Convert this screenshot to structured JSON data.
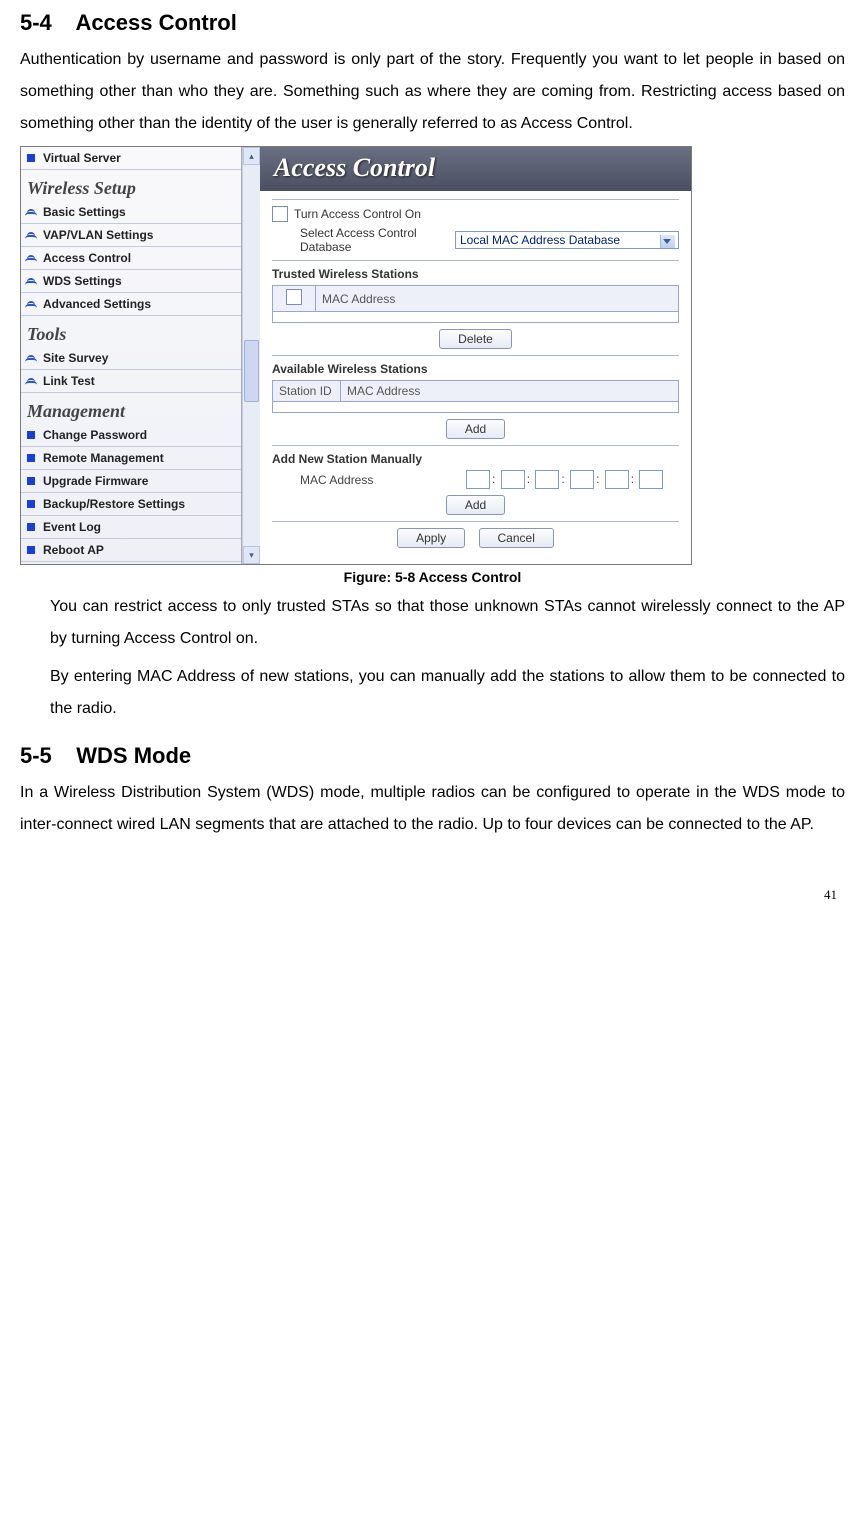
{
  "sections": {
    "s1_num": "5-4",
    "s1_title": "Access Control",
    "s1_p1": "Authentication by username and password is only part of the story. Frequently you want to let people in based on something other than who they are. Something such as where they are coming from. Restricting access based on something other than the identity of the user is generally referred to as Access Control.",
    "caption": "Figure: 5-8 Access Control",
    "after1": "You can restrict access to only trusted STAs so that those unknown STAs cannot wirelessly connect to the AP by turning Access Control on.",
    "after2": "By entering MAC Address of new stations, you can manually add the stations to allow them to be connected to the radio.",
    "s2_num": "5-5",
    "s2_title": "WDS Mode",
    "s2_p1": "In a Wireless Distribution System (WDS) mode, multiple radios can be configured to operate in the WDS mode to inter-connect wired LAN segments that are attached to the radio. Up to four devices can be connected to the AP."
  },
  "sidebar": {
    "virtual_server": "Virtual Server",
    "h_wireless": "Wireless Setup",
    "basic": "Basic Settings",
    "vap": "VAP/VLAN Settings",
    "access": "Access Control",
    "wds": "WDS Settings",
    "adv": "Advanced Settings",
    "h_tools": "Tools",
    "site": "Site Survey",
    "link": "Link Test",
    "h_mgmt": "Management",
    "change_pw": "Change Password",
    "remote": "Remote Management",
    "upgrade": "Upgrade Firmware",
    "backup": "Backup/Restore Settings",
    "event": "Event Log",
    "reboot": "Reboot AP"
  },
  "panel": {
    "title": "Access Control",
    "turn_on": "Turn Access Control On",
    "select_db": "Select Access Control Database",
    "db_value": "Local MAC Address Database",
    "trusted_h": "Trusted Wireless Stations",
    "mac_col": "MAC Address",
    "delete": "Delete",
    "avail_h": "Available Wireless Stations",
    "station_id": "Station ID",
    "add": "Add",
    "add_new_h": "Add New Station Manually",
    "mac_lbl": "MAC Address",
    "apply": "Apply",
    "cancel": "Cancel"
  },
  "page_number": "41"
}
